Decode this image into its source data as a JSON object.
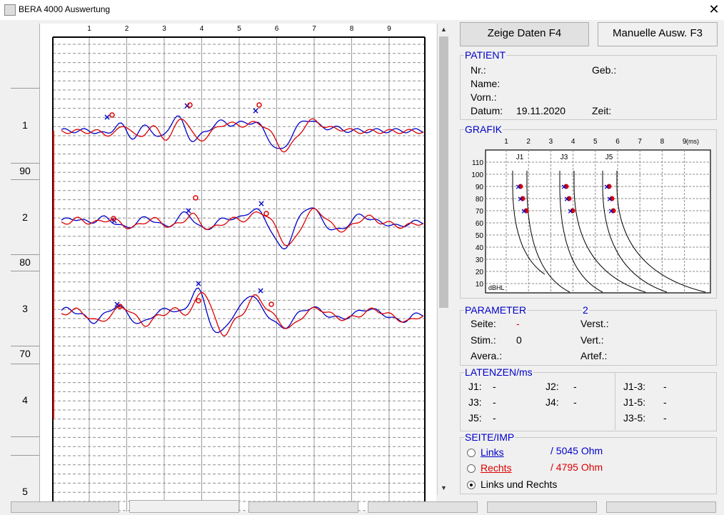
{
  "window": {
    "title": "BERA 4000    Auswertung",
    "close": "✕"
  },
  "rail": {
    "labels": [
      "1",
      "90",
      "2",
      "80",
      "3",
      "70",
      "4",
      "5"
    ]
  },
  "plot": {
    "x_ticks": [
      "1",
      "2",
      "3",
      "4",
      "5",
      "6",
      "7",
      "8",
      "9"
    ]
  },
  "buttons": {
    "zeige_daten": "Zeige Daten   F4",
    "manuelle": "Manuelle Ausw. F3"
  },
  "patient": {
    "title": "PATIENT",
    "nr_label": "Nr.:",
    "geb_label": "Geb.:",
    "name_label": "Name:",
    "vorn_label": "Vorn.:",
    "datum_label": "Datum:",
    "datum_value": "19.11.2020",
    "zeit_label": "Zeit:"
  },
  "grafik": {
    "title": "GRAFIK",
    "x_ticks": [
      "1",
      "2",
      "3",
      "4",
      "5",
      "6",
      "7",
      "8",
      "9"
    ],
    "x_unit": "(ms)",
    "y_ticks": [
      "110",
      "100",
      "90",
      "80",
      "70",
      "60",
      "50",
      "40",
      "30",
      "20",
      "10"
    ],
    "y_unit": "dBHL",
    "peak_labels": [
      "J1",
      "J3",
      "J5"
    ]
  },
  "parameter": {
    "title": "PARAMETER",
    "number": "2",
    "seite_label": "Seite:",
    "seite_value": "-",
    "verst_label": "Verst.:",
    "stim_label": "Stim.:",
    "stim_value": "0",
    "vert_label": "Vert.:",
    "avera_label": "Avera.:",
    "artef_label": "Artef.:"
  },
  "latenzen": {
    "title": "LATENZEN/ms",
    "j1_label": "J1:",
    "j1_value": "-",
    "j2_label": "J2:",
    "j2_value": "-",
    "j13_label": "J1-3:",
    "j13_value": "-",
    "j3_label": "J3:",
    "j3_value": "-",
    "j4_label": "J4:",
    "j4_value": "-",
    "j15_label": "J1-5:",
    "j15_value": "-",
    "j5_label": "J5:",
    "j5_value": "-",
    "j35_label": "J3-5:",
    "j35_value": "-"
  },
  "seite_imp": {
    "title": "SEITE/IMP",
    "links_label": "Links",
    "links_value": "/ 5045 Ohm",
    "rechts_label": "Rechts",
    "rechts_value": "/ 4795 Ohm",
    "beide_label": "Links und Rechts"
  },
  "colors": {
    "left": "#0000c8",
    "right": "#dc0000",
    "group_title": "#0000c8"
  }
}
